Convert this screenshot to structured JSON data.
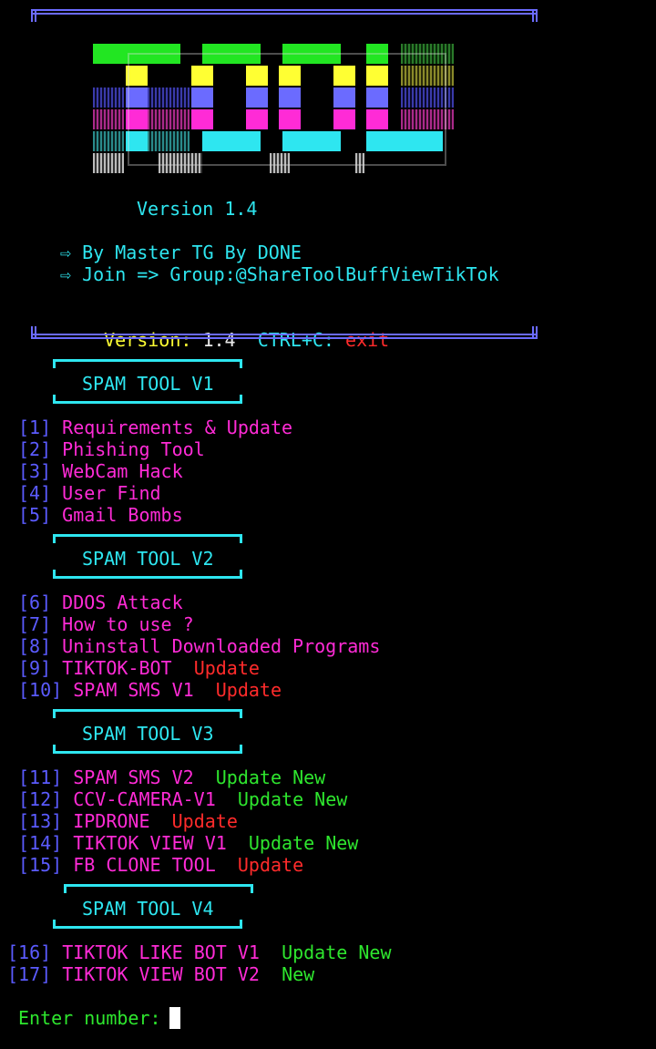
{
  "banner": {
    "logo_text": "TOOL",
    "version_center": "Version 1.4",
    "author_line": "⇨ By Master TG By DONE",
    "join_line": "⇨ Join => Group:@ShareToolBuffViewTikTok",
    "version_label": "Version:",
    "version_value": "1.4",
    "ctrl_label": "CTRL+C:",
    "ctrl_value": "exit"
  },
  "sections": [
    {
      "title": "SPAM TOOL V1"
    },
    {
      "title": "SPAM TOOL V2"
    },
    {
      "title": "SPAM TOOL V3"
    },
    {
      "title": "SPAM TOOL V4"
    }
  ],
  "menu": [
    {
      "num": "[1]",
      "label": "Requirements & Update",
      "tag1": "",
      "tag2": ""
    },
    {
      "num": "[2]",
      "label": "Phishing Tool",
      "tag1": "",
      "tag2": ""
    },
    {
      "num": "[3]",
      "label": "WebCam Hack",
      "tag1": "",
      "tag2": ""
    },
    {
      "num": "[4]",
      "label": "User Find",
      "tag1": "",
      "tag2": ""
    },
    {
      "num": "[5]",
      "label": "Gmail Bombs",
      "tag1": "",
      "tag2": ""
    },
    {
      "num": "[6]",
      "label": "DDOS Attack",
      "tag1": "",
      "tag2": ""
    },
    {
      "num": "[7]",
      "label": "How to use ?",
      "tag1": "",
      "tag2": ""
    },
    {
      "num": "[8]",
      "label": "Uninstall Downloaded Programs",
      "tag1": "",
      "tag2": ""
    },
    {
      "num": "[9]",
      "label": "TIKTOK-BOT",
      "tag1": "Update",
      "tag2": ""
    },
    {
      "num": "[10]",
      "label": "SPAM SMS V1",
      "tag1": "Update",
      "tag2": ""
    },
    {
      "num": "[11]",
      "label": "SPAM SMS V2",
      "tag1": "Update",
      "tag2": "New"
    },
    {
      "num": "[12]",
      "label": "CCV-CAMERA-V1",
      "tag1": "Update",
      "tag2": "New"
    },
    {
      "num": "[13]",
      "label": "IPDRONE",
      "tag1": "Update",
      "tag2": ""
    },
    {
      "num": "[14]",
      "label": "TIKTOK VIEW V1",
      "tag1": "Update",
      "tag2": "New"
    },
    {
      "num": "[15]",
      "label": "FB CLONE TOOL",
      "tag1": "Update",
      "tag2": ""
    },
    {
      "num": "[16]",
      "label": "TIKTOK LIKE BOT V1",
      "tag1": "Update",
      "tag2": "New"
    },
    {
      "num": "[17]",
      "label": "TIKTOK VIEW BOT V2",
      "tag1": "",
      "tag2": "New"
    }
  ],
  "prompt": {
    "label": "Enter number:"
  },
  "colors": {
    "cyan": "#2ee6f0",
    "magenta": "#ff2bd6",
    "yellow": "#ffff33",
    "red": "#ff2b2b",
    "green": "#2ee62e",
    "blue": "#5b5bff"
  }
}
